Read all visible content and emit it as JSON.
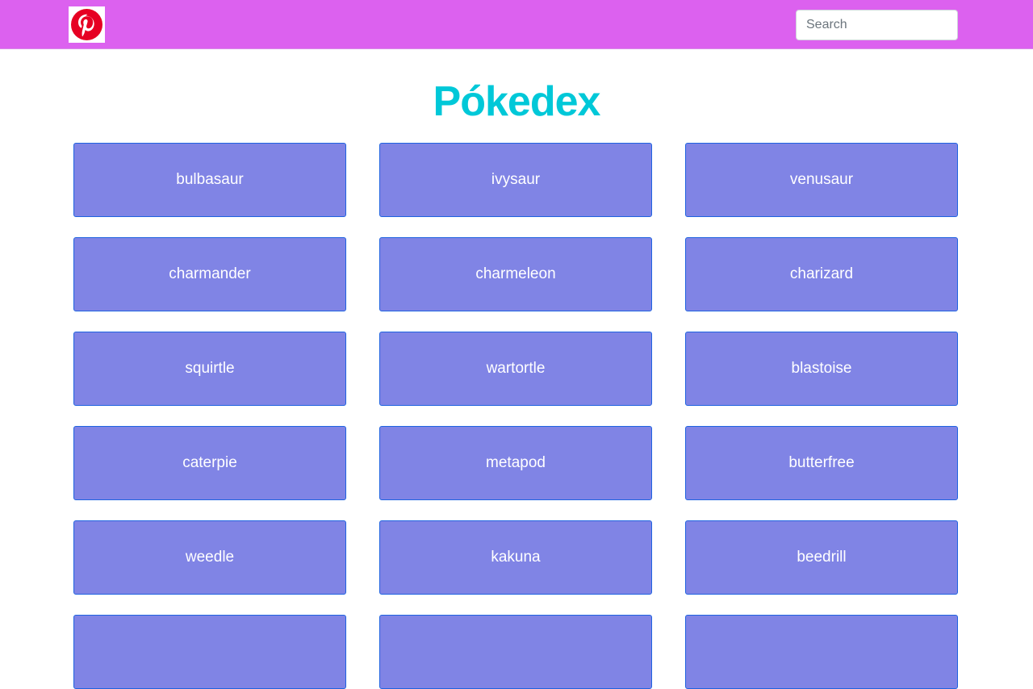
{
  "header": {
    "logo_icon": "pinterest-logo-icon",
    "logo_color": "#e60023",
    "search_placeholder": "Search",
    "background_color": "#dc61ef"
  },
  "page": {
    "title": "Pókedex",
    "title_color": "#00c8d8"
  },
  "card_style": {
    "background_color": "#8084e5",
    "border_color": "#1f63e0",
    "text_color": "#ffffff"
  },
  "pokemon": [
    {
      "name": "bulbasaur"
    },
    {
      "name": "ivysaur"
    },
    {
      "name": "venusaur"
    },
    {
      "name": "charmander"
    },
    {
      "name": "charmeleon"
    },
    {
      "name": "charizard"
    },
    {
      "name": "squirtle"
    },
    {
      "name": "wartortle"
    },
    {
      "name": "blastoise"
    },
    {
      "name": "caterpie"
    },
    {
      "name": "metapod"
    },
    {
      "name": "butterfree"
    },
    {
      "name": "weedle"
    },
    {
      "name": "kakuna"
    },
    {
      "name": "beedrill"
    },
    {
      "name": ""
    },
    {
      "name": ""
    },
    {
      "name": ""
    }
  ]
}
